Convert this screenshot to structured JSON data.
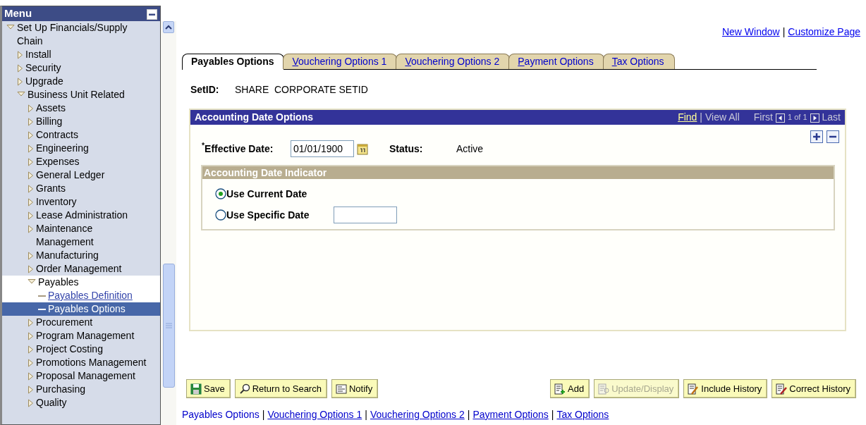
{
  "menu": {
    "title": "Menu",
    "items": [
      {
        "label": "Set Up Financials/Supply Chain",
        "kind": "folder",
        "expanded": true,
        "children": [
          {
            "label": "Install",
            "kind": "folder",
            "expanded": false
          },
          {
            "label": "Security",
            "kind": "folder",
            "expanded": false
          },
          {
            "label": "Upgrade",
            "kind": "folder",
            "expanded": false
          },
          {
            "label": "Business Unit Related",
            "kind": "folder",
            "expanded": true,
            "children": [
              {
                "label": "Assets",
                "kind": "folder",
                "expanded": false
              },
              {
                "label": "Billing",
                "kind": "folder",
                "expanded": false
              },
              {
                "label": "Contracts",
                "kind": "folder",
                "expanded": false
              },
              {
                "label": "Engineering",
                "kind": "folder",
                "expanded": false
              },
              {
                "label": "Expenses",
                "kind": "folder",
                "expanded": false
              },
              {
                "label": "General Ledger",
                "kind": "folder",
                "expanded": false
              },
              {
                "label": "Grants",
                "kind": "folder",
                "expanded": false
              },
              {
                "label": "Inventory",
                "kind": "folder",
                "expanded": false
              },
              {
                "label": "Lease Administration",
                "kind": "folder",
                "expanded": false
              },
              {
                "label": "Maintenance Management",
                "kind": "folder",
                "expanded": false
              },
              {
                "label": "Manufacturing",
                "kind": "folder",
                "expanded": false
              },
              {
                "label": "Order Management",
                "kind": "folder",
                "expanded": false
              },
              {
                "label": "Payables",
                "kind": "folder",
                "expanded": true,
                "children": [
                  {
                    "label": "Payables Definition",
                    "kind": "page",
                    "selected": false
                  },
                  {
                    "label": "Payables Options",
                    "kind": "page",
                    "selected": true
                  }
                ]
              },
              {
                "label": "Procurement",
                "kind": "folder",
                "expanded": false
              },
              {
                "label": "Program Management",
                "kind": "folder",
                "expanded": false
              },
              {
                "label": "Project Costing",
                "kind": "folder",
                "expanded": false
              },
              {
                "label": "Promotions Management",
                "kind": "folder",
                "expanded": false
              },
              {
                "label": "Proposal Management",
                "kind": "folder",
                "expanded": false
              },
              {
                "label": "Purchasing",
                "kind": "folder",
                "expanded": false
              },
              {
                "label": "Quality",
                "kind": "folder",
                "expanded": false
              }
            ]
          }
        ]
      }
    ]
  },
  "header_links": {
    "separator": "|",
    "links": [
      "New Window",
      "Customize Page"
    ]
  },
  "tabs": [
    {
      "label": "Payables Options",
      "selected": true
    },
    {
      "label": "Vouchering Options 1",
      "selected": false
    },
    {
      "label": "Vouchering Options 2",
      "selected": false
    },
    {
      "label": "Payment Options",
      "selected": false
    },
    {
      "label": "Tax Options",
      "selected": false
    }
  ],
  "setid": {
    "label": "SetID:",
    "value": "SHARE",
    "description": "CORPORATE SETID"
  },
  "grid": {
    "title": "Accounting Date Options",
    "find": "Find",
    "separator": "|",
    "view_all": "View All",
    "first": "First",
    "count": "1 of 1",
    "last": "Last",
    "effective_date": {
      "label": "$^{*}$Effective Date:",
      "value": "01/01/1900"
    },
    "status": {
      "label": "Status:",
      "value": "Active"
    },
    "indicator": {
      "title": "Accounting Date Indicator",
      "options": [
        {
          "label": "Use Current Date",
          "selected": true,
          "kind": "radio"
        },
        {
          "label": "Use Specific Date",
          "selected": false,
          "kind": "radio-date"
        }
      ]
    }
  },
  "buttons_left": [
    {
      "label": "Save",
      "kind": "save",
      "disabled": false
    },
    {
      "label": "Return to Search",
      "kind": "search",
      "disabled": false
    },
    {
      "label": "Notify",
      "kind": "notify",
      "disabled": false
    }
  ],
  "buttons_right": [
    {
      "label": "Add",
      "kind": "add",
      "disabled": false
    },
    {
      "label": "Update/Display",
      "kind": "update",
      "disabled": true
    },
    {
      "label": "Include History",
      "kind": "include",
      "disabled": false
    },
    {
      "label": "Correct History",
      "kind": "correct",
      "disabled": false
    }
  ],
  "page_links": {
    "separator": "|",
    "links": [
      {
        "label": "Payables Options",
        "selected": true
      },
      {
        "label": "Vouchering Options 1",
        "selected": false
      },
      {
        "label": "Vouchering Options 2",
        "selected": false
      },
      {
        "label": "Payment Options",
        "selected": false
      },
      {
        "label": "Tax Options",
        "selected": false
      }
    ]
  }
}
